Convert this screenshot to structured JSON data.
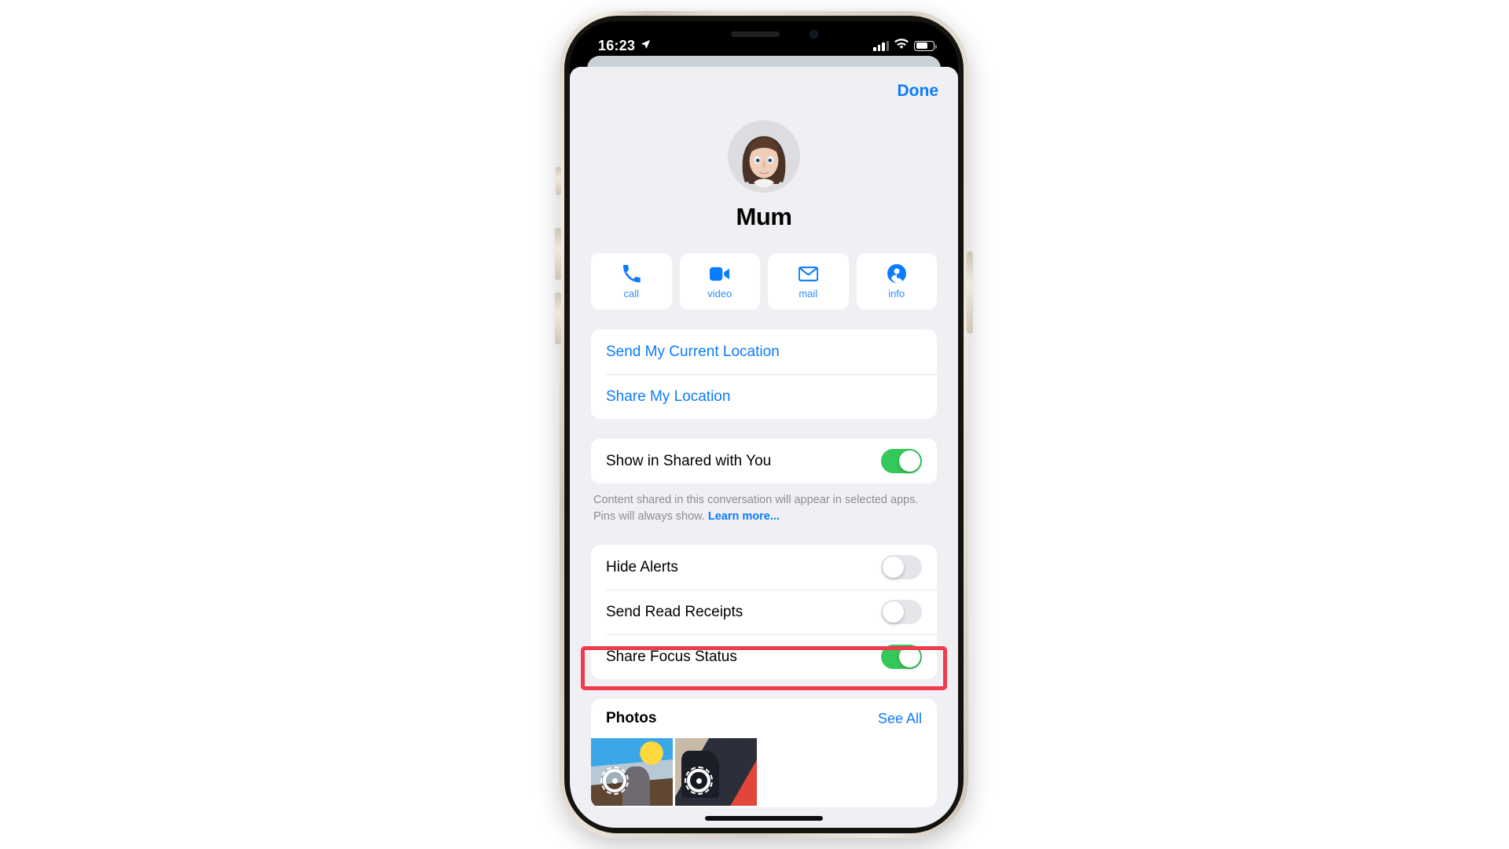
{
  "status_bar": {
    "time": "16:23",
    "location_icon": "location-arrow-icon",
    "cellular_icon": "cellular-bars-icon",
    "wifi_icon": "wifi-icon",
    "battery_icon": "battery-icon",
    "battery_level_percent": 68
  },
  "sheet": {
    "done_label": "Done"
  },
  "contact": {
    "name": "Mum",
    "avatar": "memoji-avatar"
  },
  "actions": [
    {
      "label": "call",
      "icon": "phone-icon"
    },
    {
      "label": "video",
      "icon": "video-camera-icon"
    },
    {
      "label": "mail",
      "icon": "envelope-icon"
    },
    {
      "label": "info",
      "icon": "person-circle-icon"
    }
  ],
  "location_group": [
    {
      "label": "Send My Current Location"
    },
    {
      "label": "Share My Location"
    }
  ],
  "shared_with_you": {
    "label": "Show in Shared with You",
    "enabled": true,
    "footnote": "Content shared in this conversation will appear in selected apps. Pins will always show.",
    "footnote_link": "Learn more..."
  },
  "settings_group": [
    {
      "label": "Hide Alerts",
      "enabled": false,
      "highlighted": false
    },
    {
      "label": "Send Read Receipts",
      "enabled": false,
      "highlighted": false
    },
    {
      "label": "Share Focus Status",
      "enabled": true,
      "highlighted": true
    }
  ],
  "photos": {
    "title": "Photos",
    "see_all_label": "See All",
    "thumbnails": [
      "photo-thumbnail-1",
      "photo-thumbnail-2"
    ]
  },
  "colors": {
    "accent_blue": "#0a7cff",
    "toggle_green": "#34c759",
    "highlight_red": "#f03b4c",
    "sheet_background": "#f0eff4"
  }
}
